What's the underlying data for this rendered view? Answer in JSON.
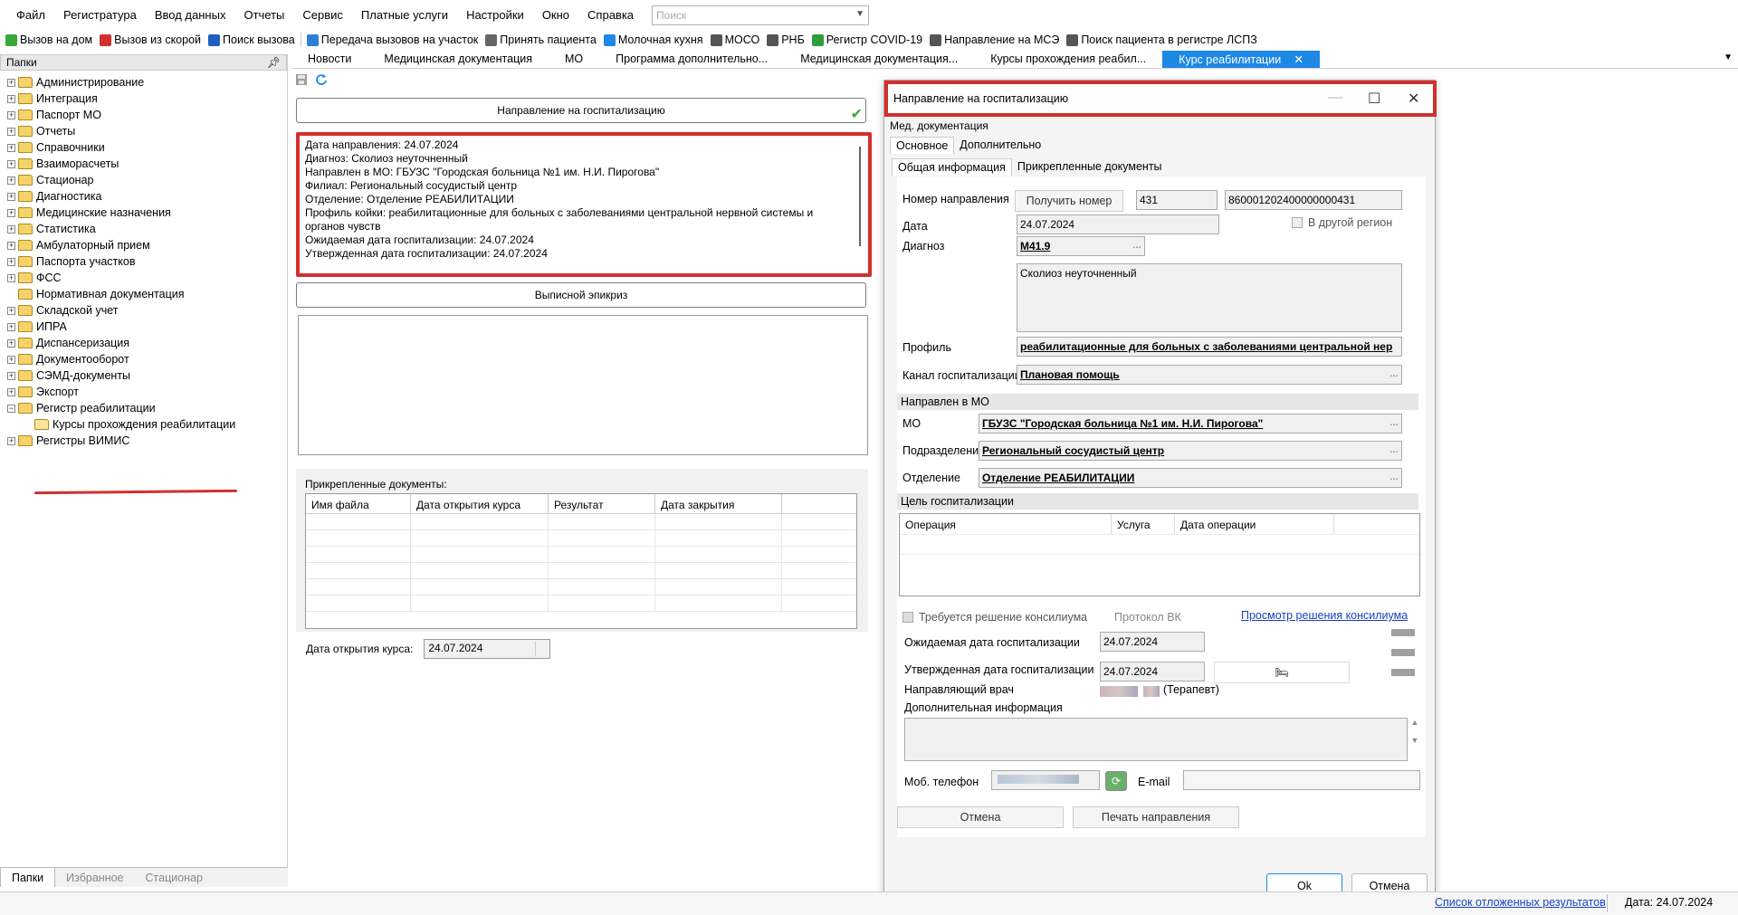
{
  "menu": [
    "Файл",
    "Регистратура",
    "Ввод данных",
    "Отчеты",
    "Сервис",
    "Платные услуги",
    "Настройки",
    "Окно",
    "Справка"
  ],
  "search": {
    "placeholder": "Поиск"
  },
  "toolbar": [
    {
      "label": "Вызов на дом",
      "icon": "house-icon",
      "color": "#3aa83a"
    },
    {
      "label": "Вызов из скорой",
      "icon": "ambulance-icon",
      "color": "#d32f2f"
    },
    {
      "label": "Поиск вызова",
      "icon": "search-call-icon",
      "color": "#1e5fbf"
    },
    {
      "label": "Передача вызовов на участок",
      "icon": "transfer-icon",
      "color": "#2f7fd6"
    },
    {
      "label": "Принять пациента",
      "icon": "patient-icon",
      "color": "#666666"
    },
    {
      "label": "Молочная кухня",
      "icon": "milk-icon",
      "color": "#1e88e5"
    },
    {
      "label": "МОСО",
      "icon": "building-icon",
      "color": "#555555"
    },
    {
      "label": "РНБ",
      "icon": "registry-icon",
      "color": "#555555"
    },
    {
      "label": "Регистр COVID-19",
      "icon": "virus-icon",
      "color": "#2e9e3a"
    },
    {
      "label": "Направление на МСЭ",
      "icon": "referral-icon",
      "color": "#555555"
    },
    {
      "label": "Поиск пациента в регистре ЛСПЗ",
      "icon": "patient-search-icon",
      "color": "#555555"
    }
  ],
  "left_panel": {
    "title": "Папки",
    "tree": [
      {
        "label": "Администрирование",
        "exp": "+"
      },
      {
        "label": "Интеграция",
        "exp": "+"
      },
      {
        "label": "Паспорт МО",
        "exp": "+"
      },
      {
        "label": "Отчеты",
        "exp": "+"
      },
      {
        "label": "Справочники",
        "exp": "+"
      },
      {
        "label": "Взаиморасчеты",
        "exp": "+"
      },
      {
        "label": "Стационар",
        "exp": "+"
      },
      {
        "label": "Диагностика",
        "exp": "+"
      },
      {
        "label": "Медицинские назначения",
        "exp": "+"
      },
      {
        "label": "Статистика",
        "exp": "+"
      },
      {
        "label": "Амбулаторный прием",
        "exp": "+"
      },
      {
        "label": "Паспорта участков",
        "exp": "+"
      },
      {
        "label": "ФСС",
        "exp": "+"
      },
      {
        "label": "Нормативная документация",
        "exp": ""
      },
      {
        "label": "Складской учет",
        "exp": "+"
      },
      {
        "label": "ИПРА",
        "exp": "+"
      },
      {
        "label": "Диспансеризация",
        "exp": "+"
      },
      {
        "label": "Документооборот",
        "exp": "+"
      },
      {
        "label": "СЭМД-документы",
        "exp": "+"
      },
      {
        "label": "Экспорт",
        "exp": "+"
      },
      {
        "label": "Регистр реабилитации",
        "exp": "−"
      },
      {
        "label": "Курсы прохождения реабилитации",
        "exp": "",
        "child": true,
        "open": true
      },
      {
        "label": "Регистры ВИМИС",
        "exp": "+"
      }
    ],
    "tabs": [
      "Папки",
      "Избранное",
      "Стационар"
    ]
  },
  "doc_tabs": [
    "Новости",
    "Медицинская документация",
    "МО",
    "Программа дополнительно...",
    "Медицинская документация...",
    "Курсы прохождения реабил...",
    "Курс реабилитации"
  ],
  "main": {
    "hosp_button": "Направление на госпитализацию",
    "info_lines": [
      "Дата направления: 24.07.2024",
      "Диагноз: Сколиоз неуточненный",
      "Направлен в МО: ГБУЗС \"Городская больница №1 им. Н.И. Пирогова\"",
      "Филиал: Региональный сосудистый центр",
      "Отделение: Отделение РЕАБИЛИТАЦИИ",
      "Профиль койки: реабилитационные для больных с заболеваниями центральной нервной системы и органов чувств",
      "Ожидаемая дата госпитализации: 24.07.2024",
      "Утвержденная дата госпитализации: 24.07.2024"
    ],
    "epicrisis_button": "Выписной эпикриз",
    "attached_title": "Прикрепленные документы:",
    "attached_columns": [
      "Имя файла",
      "Дата открытия курса",
      "Результат",
      "Дата закрытия"
    ],
    "open_date_label": "Дата открытия курса:",
    "open_date_value": "24.07.2024"
  },
  "modal": {
    "title": "Направление на госпитализацию",
    "subtitle": "Мед. документация",
    "tabs1": [
      "Основное",
      "Дополнительно"
    ],
    "tabs2": [
      "Общая информация",
      "Прикрепленные документы"
    ],
    "number_label": "Номер направления",
    "get_number_button": "Получить номер",
    "number_short": "431",
    "number_full": "860001202400000000431",
    "date_label": "Дата",
    "date_value": "24.07.2024",
    "other_region_label": "В другой регион",
    "diagnosis_label": "Диагноз",
    "diagnosis_code": "M41.9",
    "diagnosis_text": "Сколиоз неуточненный",
    "profile_label": "Профиль",
    "profile_value": "реабилитационные для больных с заболеваниями центральной нер",
    "channel_label": "Канал госпитализации",
    "channel_value": "Плановая помощь",
    "mo_section": "Направлен в МО",
    "mo_label": "МО",
    "mo_value": "ГБУЗС \"Городская больница №1 им. Н.И. Пирогова\"",
    "subdivision_label": "Подразделение",
    "subdivision_value": "Региональный сосудистый центр",
    "department_label": "Отделение",
    "department_value": "Отделение РЕАБИЛИТАЦИИ",
    "goal_section": "Цель госпитализации",
    "goal_columns": [
      "Операция",
      "Услуга",
      "Дата операции"
    ],
    "council_label": "Требуется решение консилиума",
    "protocol_label": "Протокол ВК",
    "council_link": "Просмотр решения консилиума",
    "expected_label": "Ожидаемая дата госпитализации",
    "expected_value": "24.07.2024",
    "approved_label": "Утвержденная дата госпитализации",
    "approved_value": "24.07.2024",
    "doctor_label": "Направляющий врач",
    "doctor_role": "(Терапевт)",
    "extra_label": "Дополнительная информация",
    "phone_label": "Моб. телефон",
    "email_label": "E-mail",
    "cancel_inner": "Отмена",
    "print_button": "Печать направления",
    "ok_button": "Ok",
    "cancel_button": "Отмена"
  },
  "status": {
    "link": "Список отложенных результатов",
    "date": "Дата: 24.07.2024"
  },
  "colors": {
    "accent": "#1e88e5",
    "highlight": "#d32f2f"
  }
}
